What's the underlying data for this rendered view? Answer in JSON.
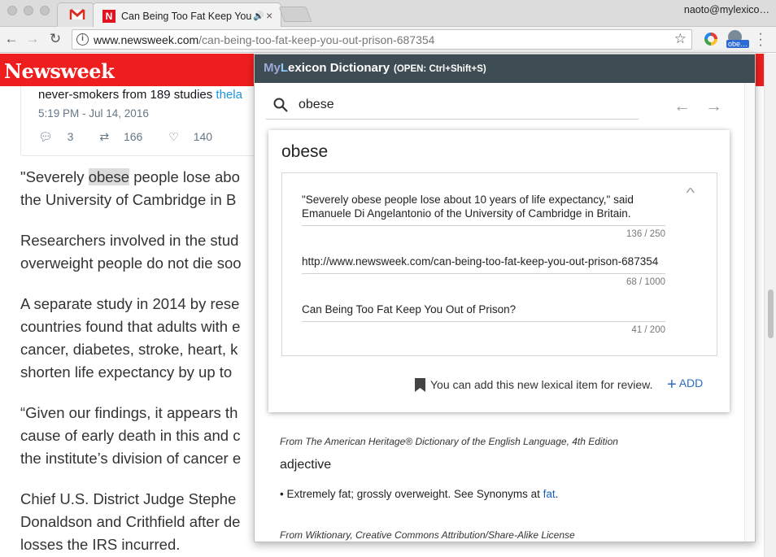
{
  "browser": {
    "tabs": [
      {
        "title": "",
        "icon": "gmail-icon"
      },
      {
        "title": "Can Being Too Fat Keep You Out of Prison?",
        "icon": "newsweek-icon",
        "audio": "🔊",
        "close": "×"
      }
    ],
    "profile": "naoto@mylexico…",
    "url_host": "www.newsweek.com",
    "url_path": "/can-being-too-fat-keep-you-out-prison-687354",
    "ext_badge": "obe…"
  },
  "page": {
    "logo": "Newsweek",
    "tweet": {
      "text": "never-smokers from 189 studies ",
      "link": "thela",
      "time": "5:19 PM - Jul 14, 2016",
      "replies": "3",
      "retweets": "166",
      "likes": "140"
    },
    "paragraphs": [
      {
        "pre": "\"Severely ",
        "hl": "obese",
        "post": " people lose abo",
        "line2": "the University of Cambridge in B"
      },
      {
        "line1": "Researchers involved in the stud",
        "line2": "overweight people do not die soo"
      },
      {
        "line1": "A separate study in 2014 by rese",
        "line2": "countries found that adults with e",
        "line3": "cancer, diabetes, stroke, heart, k",
        "line4": "shorten life expectancy by up to "
      },
      {
        "line1": "“Given our findings, it appears th",
        "line2": "cause of early death in this and c",
        "line3": "the institute’s division of cancer e"
      },
      {
        "line1": "Chief U.S. District Judge Stephe",
        "line2": "Donaldson and Crithfield after de",
        "line3": "losses the IRS incurred."
      }
    ]
  },
  "popup": {
    "brand_m": "My",
    "brand_l": "L",
    "brand_rest": "exicon Dictionary",
    "shortcut": "(OPEN: Ctrl+Shift+S)",
    "search_value": "obese",
    "card": {
      "word": "obese",
      "sentence": "\"Severely obese people lose about 10 years of life expectancy,\" said Emanuele Di Angelantonio of the University of Cambridge in Britain.",
      "sentence_count": "136 / 250",
      "url": "http://www.newsweek.com/can-being-too-fat-keep-you-out-prison-687354",
      "url_count": "68 / 1000",
      "title": "Can Being Too Fat Keep You Out of Prison?",
      "title_count": "41 / 200",
      "add_message": "You can add this new lexical item for review.",
      "add_label": "ADD"
    },
    "source1": "From The American Heritage® Dictionary of the English Language, 4th Edition",
    "part_of_speech": "adjective",
    "definition_text": "• Extremely fat; grossly overweight. See Synonyms at ",
    "definition_link": "fat",
    "definition_end": ".",
    "source2": "From Wiktionary, Creative Commons Attribution/Share-Alike License"
  }
}
